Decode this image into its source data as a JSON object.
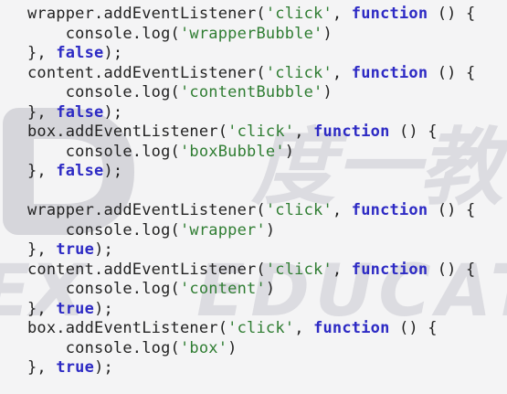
{
  "colors": {
    "background": "#f4f4f5",
    "plain": "#222222",
    "keyword": "#2d2ac4",
    "string": "#2f7d32",
    "watermark": "#cfcfd4"
  },
  "watermark": {
    "text_top": "度一教",
    "text_bottom": "EDUCAT",
    "logo_shape": "D-logo"
  },
  "code_lines": [
    [
      {
        "t": "wrapper.addEventListener(",
        "c": "plain"
      },
      {
        "t": "'click'",
        "c": "string"
      },
      {
        "t": ", ",
        "c": "plain"
      },
      {
        "t": "function",
        "c": "keyword"
      },
      {
        "t": " () {",
        "c": "plain"
      }
    ],
    [
      {
        "t": "    console.log(",
        "c": "plain"
      },
      {
        "t": "'wrapperBubble'",
        "c": "string"
      },
      {
        "t": ")",
        "c": "plain"
      }
    ],
    [
      {
        "t": "}, ",
        "c": "plain"
      },
      {
        "t": "false",
        "c": "keyword"
      },
      {
        "t": ");",
        "c": "plain"
      }
    ],
    [
      {
        "t": "content.addEventListener(",
        "c": "plain"
      },
      {
        "t": "'click'",
        "c": "string"
      },
      {
        "t": ", ",
        "c": "plain"
      },
      {
        "t": "function",
        "c": "keyword"
      },
      {
        "t": " () {",
        "c": "plain"
      }
    ],
    [
      {
        "t": "    console.log(",
        "c": "plain"
      },
      {
        "t": "'contentBubble'",
        "c": "string"
      },
      {
        "t": ")",
        "c": "plain"
      }
    ],
    [
      {
        "t": "}, ",
        "c": "plain"
      },
      {
        "t": "false",
        "c": "keyword"
      },
      {
        "t": ");",
        "c": "plain"
      }
    ],
    [
      {
        "t": "box.addEventListener(",
        "c": "plain"
      },
      {
        "t": "'click'",
        "c": "string"
      },
      {
        "t": ", ",
        "c": "plain"
      },
      {
        "t": "function",
        "c": "keyword"
      },
      {
        "t": " () {",
        "c": "plain"
      }
    ],
    [
      {
        "t": "    console.log(",
        "c": "plain"
      },
      {
        "t": "'boxBubble'",
        "c": "string"
      },
      {
        "t": ")",
        "c": "plain"
      }
    ],
    [
      {
        "t": "}, ",
        "c": "plain"
      },
      {
        "t": "false",
        "c": "keyword"
      },
      {
        "t": ");",
        "c": "plain"
      }
    ],
    [],
    [
      {
        "t": "wrapper.addEventListener(",
        "c": "plain"
      },
      {
        "t": "'click'",
        "c": "string"
      },
      {
        "t": ", ",
        "c": "plain"
      },
      {
        "t": "function",
        "c": "keyword"
      },
      {
        "t": " () {",
        "c": "plain"
      }
    ],
    [
      {
        "t": "    console.log(",
        "c": "plain"
      },
      {
        "t": "'wrapper'",
        "c": "string"
      },
      {
        "t": ")",
        "c": "plain"
      }
    ],
    [
      {
        "t": "}, ",
        "c": "plain"
      },
      {
        "t": "true",
        "c": "keyword"
      },
      {
        "t": ");",
        "c": "plain"
      }
    ],
    [
      {
        "t": "content.addEventListener(",
        "c": "plain"
      },
      {
        "t": "'click'",
        "c": "string"
      },
      {
        "t": ", ",
        "c": "plain"
      },
      {
        "t": "function",
        "c": "keyword"
      },
      {
        "t": " () {",
        "c": "plain"
      }
    ],
    [
      {
        "t": "    console.log(",
        "c": "plain"
      },
      {
        "t": "'content'",
        "c": "string"
      },
      {
        "t": ")",
        "c": "plain"
      }
    ],
    [
      {
        "t": "}, ",
        "c": "plain"
      },
      {
        "t": "true",
        "c": "keyword"
      },
      {
        "t": ");",
        "c": "plain"
      }
    ],
    [
      {
        "t": "box.addEventListener(",
        "c": "plain"
      },
      {
        "t": "'click'",
        "c": "string"
      },
      {
        "t": ", ",
        "c": "plain"
      },
      {
        "t": "function",
        "c": "keyword"
      },
      {
        "t": " () {",
        "c": "plain"
      }
    ],
    [
      {
        "t": "    console.log(",
        "c": "plain"
      },
      {
        "t": "'box'",
        "c": "string"
      },
      {
        "t": ")",
        "c": "plain"
      }
    ],
    [
      {
        "t": "}, ",
        "c": "plain"
      },
      {
        "t": "true",
        "c": "keyword"
      },
      {
        "t": ");",
        "c": "plain"
      }
    ]
  ]
}
